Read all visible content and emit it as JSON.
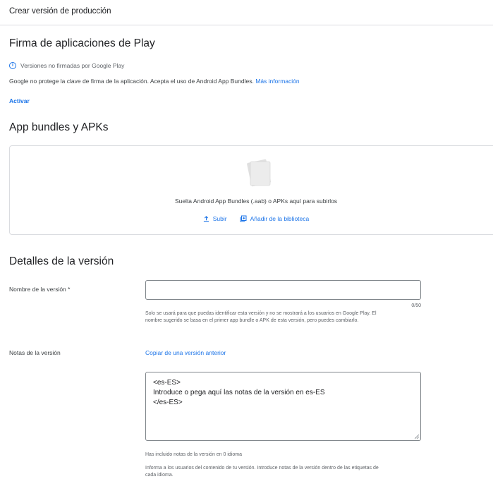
{
  "header": {
    "title": "Crear versión de producción"
  },
  "signing": {
    "heading": "Firma de aplicaciones de Play",
    "status": "Versiones no firmadas por Google Play",
    "description": "Google no protege la clave de firma de la aplicación. Acepta el uso de Android App Bundles.",
    "more_info": "Más información",
    "activate": "Activar"
  },
  "bundles": {
    "heading": "App bundles y APKs",
    "drop_text": "Suelta Android App Bundles (.aab) o APKs aquí para subirlos",
    "upload": "Subir",
    "add_from_library": "Añadir de la biblioteca"
  },
  "details": {
    "heading": "Detalles de la versión",
    "name_label": "Nombre de la versión",
    "required_mark": "*",
    "name_value": "",
    "name_counter": "0/50",
    "name_help_1": "Solo se usará para que puedas identificar esta versión y no se mostrará a los usuarios en Google Play. El",
    "name_help_2": "nombre sugerido se basa en el primer app bundle o APK de esta versión, pero puedes cambiarlo.",
    "notes_label": "Notas de la versión",
    "copy_previous": "Copiar de una versión anterior",
    "notes_line_1": "<es-ES>",
    "notes_line_2": "Introduce o pega aquí las notas de la versión en es-ES",
    "notes_line_3": "</es-ES>",
    "notes_count": "Has incluido notas de la versión en 0 idioma",
    "notes_help_1": "Informa a los usuarios del contenido de tu versión. Introduce notas de la versión dentro de las etiquetas de",
    "notes_help_2": "cada idioma."
  }
}
